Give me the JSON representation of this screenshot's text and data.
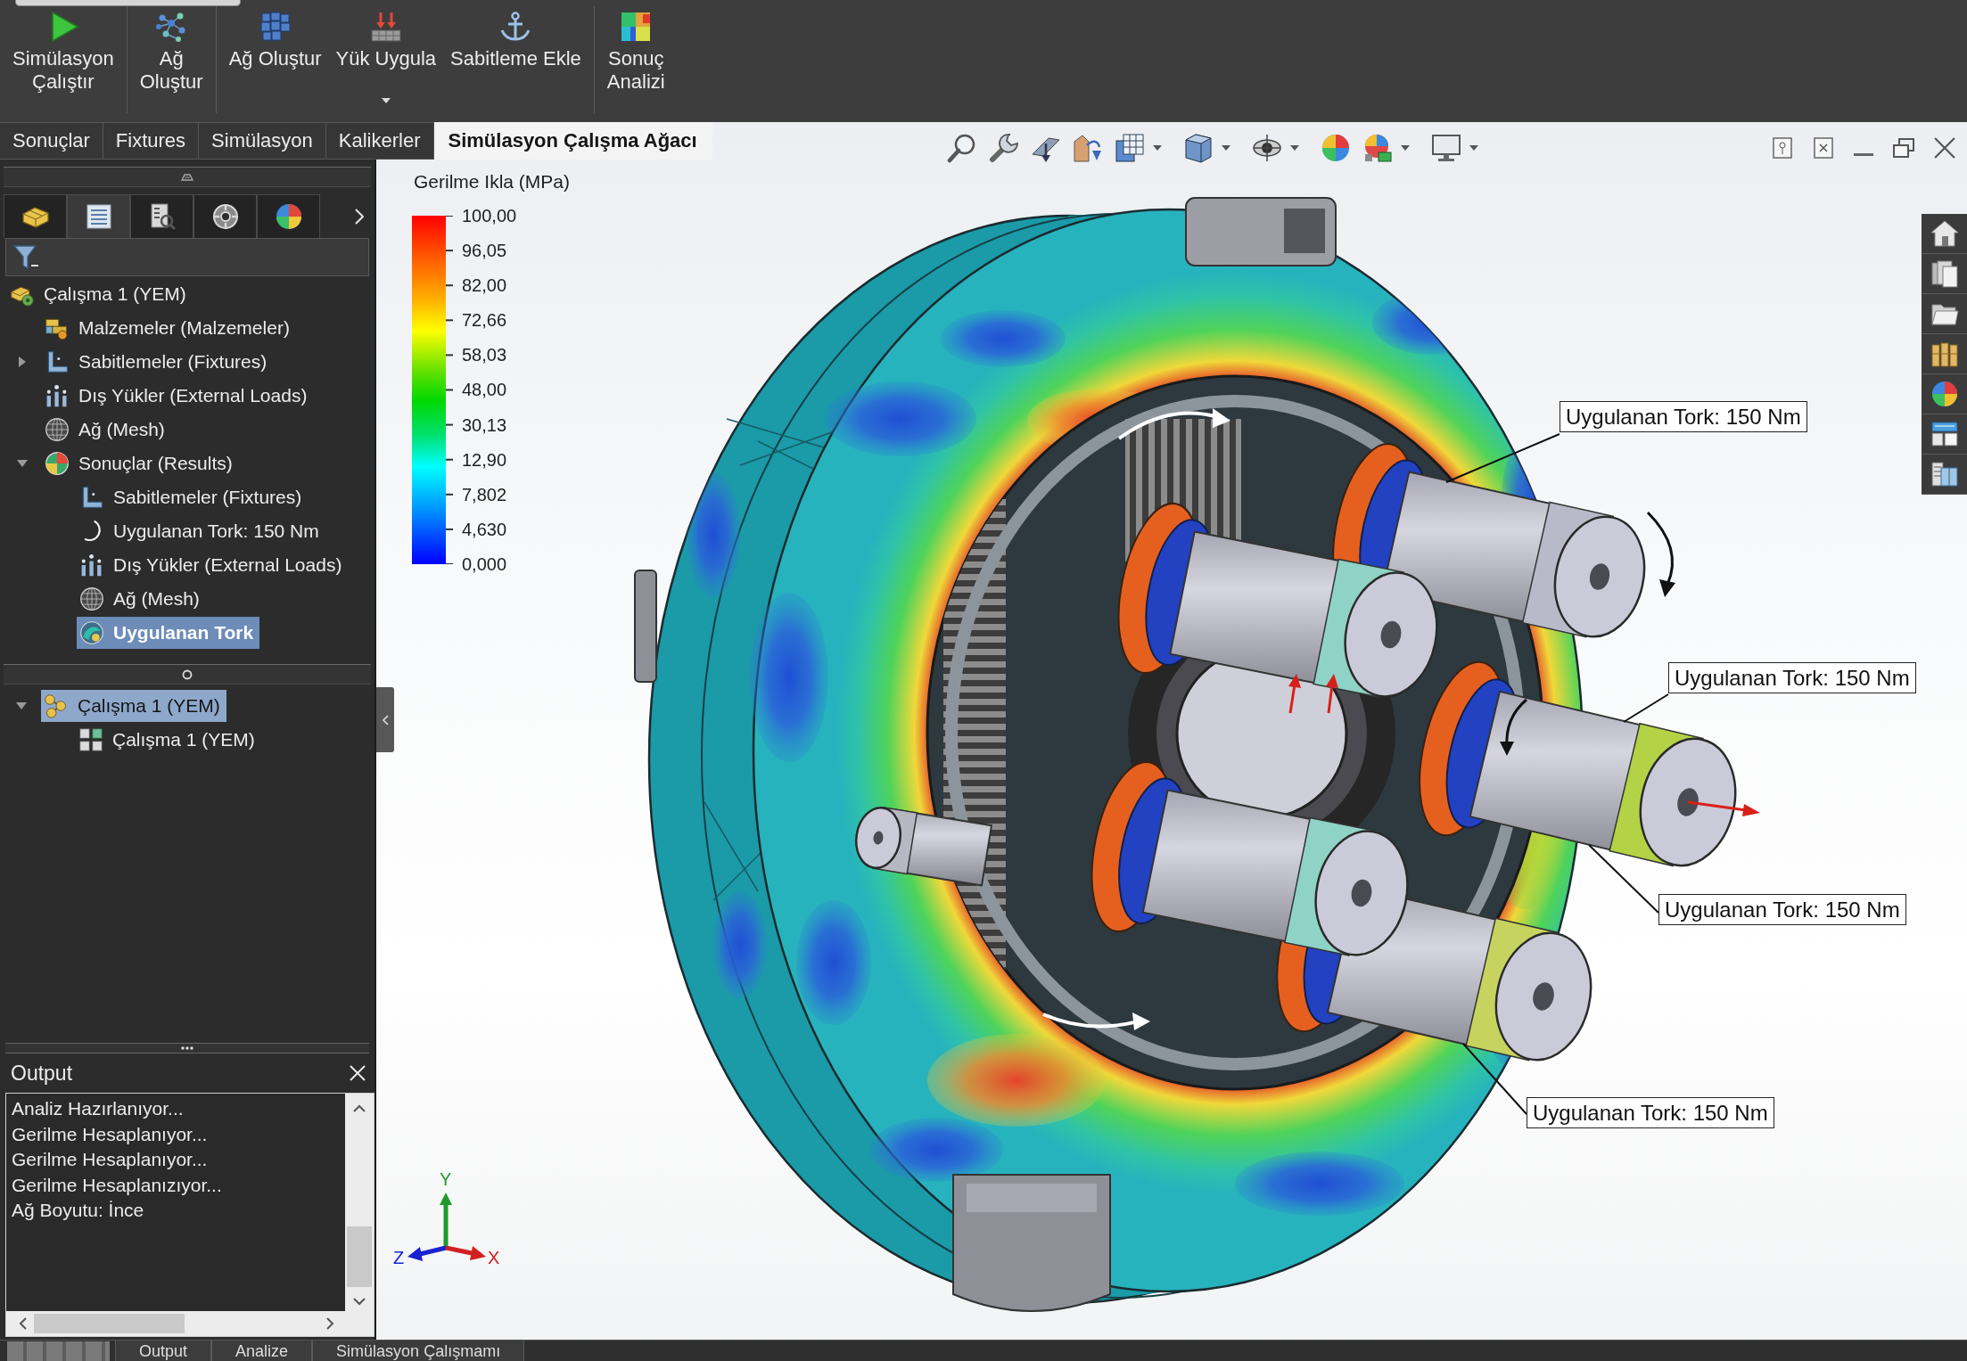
{
  "ribbon": {
    "groups": [
      {
        "buttons": [
          {
            "label": "Simülasyon\nÇalıştır",
            "kind": "run",
            "dropdown": false
          }
        ]
      },
      {
        "buttons": [
          {
            "label": "Ağ\nOluştur",
            "kind": "network",
            "dropdown": false
          }
        ]
      },
      {
        "buttons": [
          {
            "label": "Ağ Oluştur",
            "kind": "mesh",
            "dropdown": false
          },
          {
            "label": "Yük Uygula",
            "kind": "load",
            "dropdown": true
          },
          {
            "label": "Sabitleme Ekle",
            "kind": "anchor",
            "dropdown": false
          }
        ]
      },
      {
        "buttons": [
          {
            "label": "Sonuç\nAnalizi",
            "kind": "result",
            "dropdown": false
          }
        ]
      }
    ]
  },
  "ribbon_tabs": [
    {
      "label": "Sonuçlar",
      "selected": false
    },
    {
      "label": "Fixtures",
      "selected": false
    },
    {
      "label": "Simülasyon",
      "selected": false
    },
    {
      "label": "Kalikerler",
      "selected": false
    },
    {
      "label": "Simülasyon Çalışma Ağacı",
      "selected": true
    }
  ],
  "panel_tabs": [
    {
      "kind": "features",
      "selected": false
    },
    {
      "kind": "tree",
      "selected": true
    },
    {
      "kind": "properties",
      "selected": false
    },
    {
      "kind": "configuration",
      "selected": false
    },
    {
      "kind": "appearance",
      "selected": false
    }
  ],
  "study_tree": [
    {
      "label": "Çalışma 1 (YEM)",
      "kind": "study",
      "selected": false,
      "children": [
        {
          "label": "Malzemeler (Malzemeler)",
          "kind": "materials",
          "selected": false
        },
        {
          "label": "Sabitlemeler (Fixtures)",
          "kind": "fixtures",
          "selected": false,
          "expanded": false
        },
        {
          "label": "Dış Yükler (External Loads)",
          "kind": "loads",
          "selected": false
        },
        {
          "label": "Ağ (Mesh)",
          "kind": "mesh",
          "selected": false
        },
        {
          "label": "Sonuçlar (Results)",
          "kind": "results",
          "selected": false,
          "expanded": true,
          "children": [
            {
              "label": "Sabitlemeler (Fixtures)",
              "kind": "fixtures",
              "selected": false
            },
            {
              "label": "Uygulanan Tork: 150 Nm",
              "kind": "torque",
              "selected": false
            },
            {
              "label": "Dış Yükler (External Loads)",
              "kind": "loads",
              "selected": false
            },
            {
              "label": "Ağ (Mesh)",
              "kind": "mesh",
              "selected": false
            },
            {
              "label": "Uygulanan Tork",
              "kind": "plot",
              "selected": true
            }
          ]
        }
      ]
    }
  ],
  "study_manager": [
    {
      "label": "Çalışma 1 (YEM)",
      "kind": "study-group",
      "selected": true,
      "expanded": true,
      "children": [
        {
          "label": "Çalışma 1 (YEM)",
          "kind": "study-item",
          "selected": false
        }
      ]
    }
  ],
  "output": {
    "title": "Output",
    "lines": [
      "Analiz Hazırlanıyor...",
      "Gerilme Hesaplanıyor...",
      "Gerilme Hesaplanıyor...",
      "Gerilme Hesaplanızıyor...",
      "Ağ Boyutu: İnce"
    ]
  },
  "viewport": {
    "legend": {
      "title": "Gerilme Ikla (MPa)",
      "ticks": [
        "100,00",
        "96,05",
        "82,00",
        "72,66",
        "58,03",
        "48,00",
        "30,13",
        "12,90",
        "7,802",
        "4,630",
        "0,000"
      ]
    },
    "annotations": [
      {
        "text": "Uygulanan Tork: 150 Nm"
      },
      {
        "text": "Uygulanan Tork: 150 Nm"
      },
      {
        "text": "Uygulanan Tork: 150 Nm"
      },
      {
        "text": "Uygulanan Tork: 150 Nm"
      }
    ],
    "axis_triad": {
      "y": "Y",
      "z": "Z",
      "x": "X"
    }
  },
  "bottom_tabs": [
    {
      "label": "Output",
      "selected": false
    },
    {
      "label": "Analize",
      "selected": false
    },
    {
      "label": "Simülasyon Çalışmamı",
      "selected": false
    }
  ]
}
